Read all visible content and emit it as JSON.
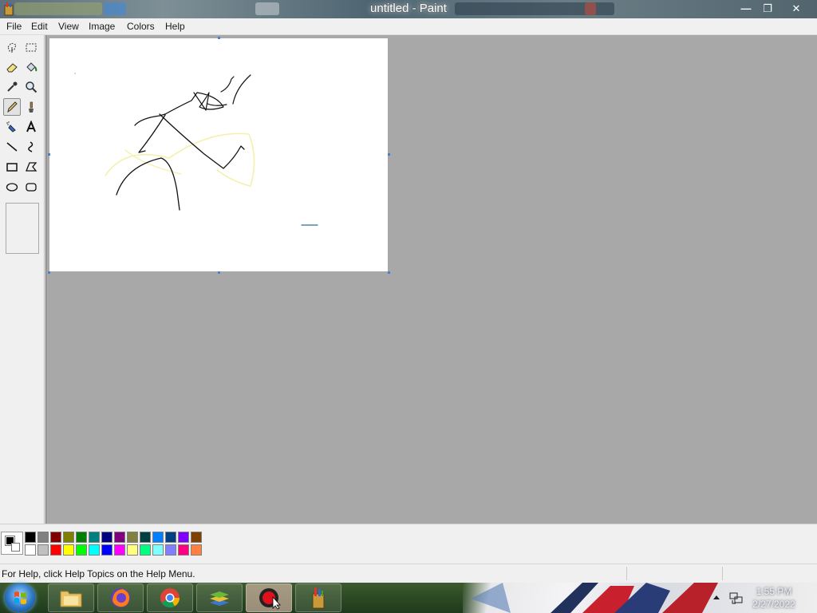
{
  "window": {
    "title": "untitled - Paint",
    "minimize": "—",
    "maximize": "❐",
    "close": "✕"
  },
  "menu": [
    "File",
    "Edit",
    "View",
    "Image",
    "Colors",
    "Help"
  ],
  "tools": [
    {
      "name": "free-form-select",
      "label": "Free-Form Select"
    },
    {
      "name": "select",
      "label": "Select"
    },
    {
      "name": "eraser",
      "label": "Eraser/Color Eraser"
    },
    {
      "name": "fill-with-color",
      "label": "Fill With Color"
    },
    {
      "name": "pick-color",
      "label": "Pick Color"
    },
    {
      "name": "magnifier",
      "label": "Magnifier"
    },
    {
      "name": "pencil",
      "label": "Pencil",
      "selected": true
    },
    {
      "name": "brush",
      "label": "Brush"
    },
    {
      "name": "airbrush",
      "label": "Airbrush"
    },
    {
      "name": "text",
      "label": "Text"
    },
    {
      "name": "line",
      "label": "Line"
    },
    {
      "name": "curve",
      "label": "Curve"
    },
    {
      "name": "rectangle",
      "label": "Rectangle"
    },
    {
      "name": "polygon",
      "label": "Polygon"
    },
    {
      "name": "ellipse",
      "label": "Ellipse"
    },
    {
      "name": "rounded-rectangle",
      "label": "Rounded Rectangle"
    }
  ],
  "colors": {
    "foreground": "#000000",
    "background": "#ffffff",
    "palette_top": [
      "#000000",
      "#808080",
      "#800000",
      "#808000",
      "#008000",
      "#008080",
      "#000080",
      "#800080",
      "#808040",
      "#004040",
      "#0080ff",
      "#004080",
      "#8000ff",
      "#804000"
    ],
    "palette_bottom": [
      "#ffffff",
      "#c0c0c0",
      "#ff0000",
      "#ffff00",
      "#00ff00",
      "#00ffff",
      "#0000ff",
      "#ff00ff",
      "#ffff80",
      "#00ff80",
      "#80ffff",
      "#8080ff",
      "#ff0080",
      "#ff8040"
    ]
  },
  "status": {
    "text": "For Help, click Help Topics on the Help Menu."
  },
  "taskbar": {
    "apps": [
      "file-explorer",
      "firefox",
      "chrome",
      "bluestacks",
      "screen-recorder",
      "paint"
    ],
    "time": "1:55 PM",
    "date": "2/27/2022"
  }
}
